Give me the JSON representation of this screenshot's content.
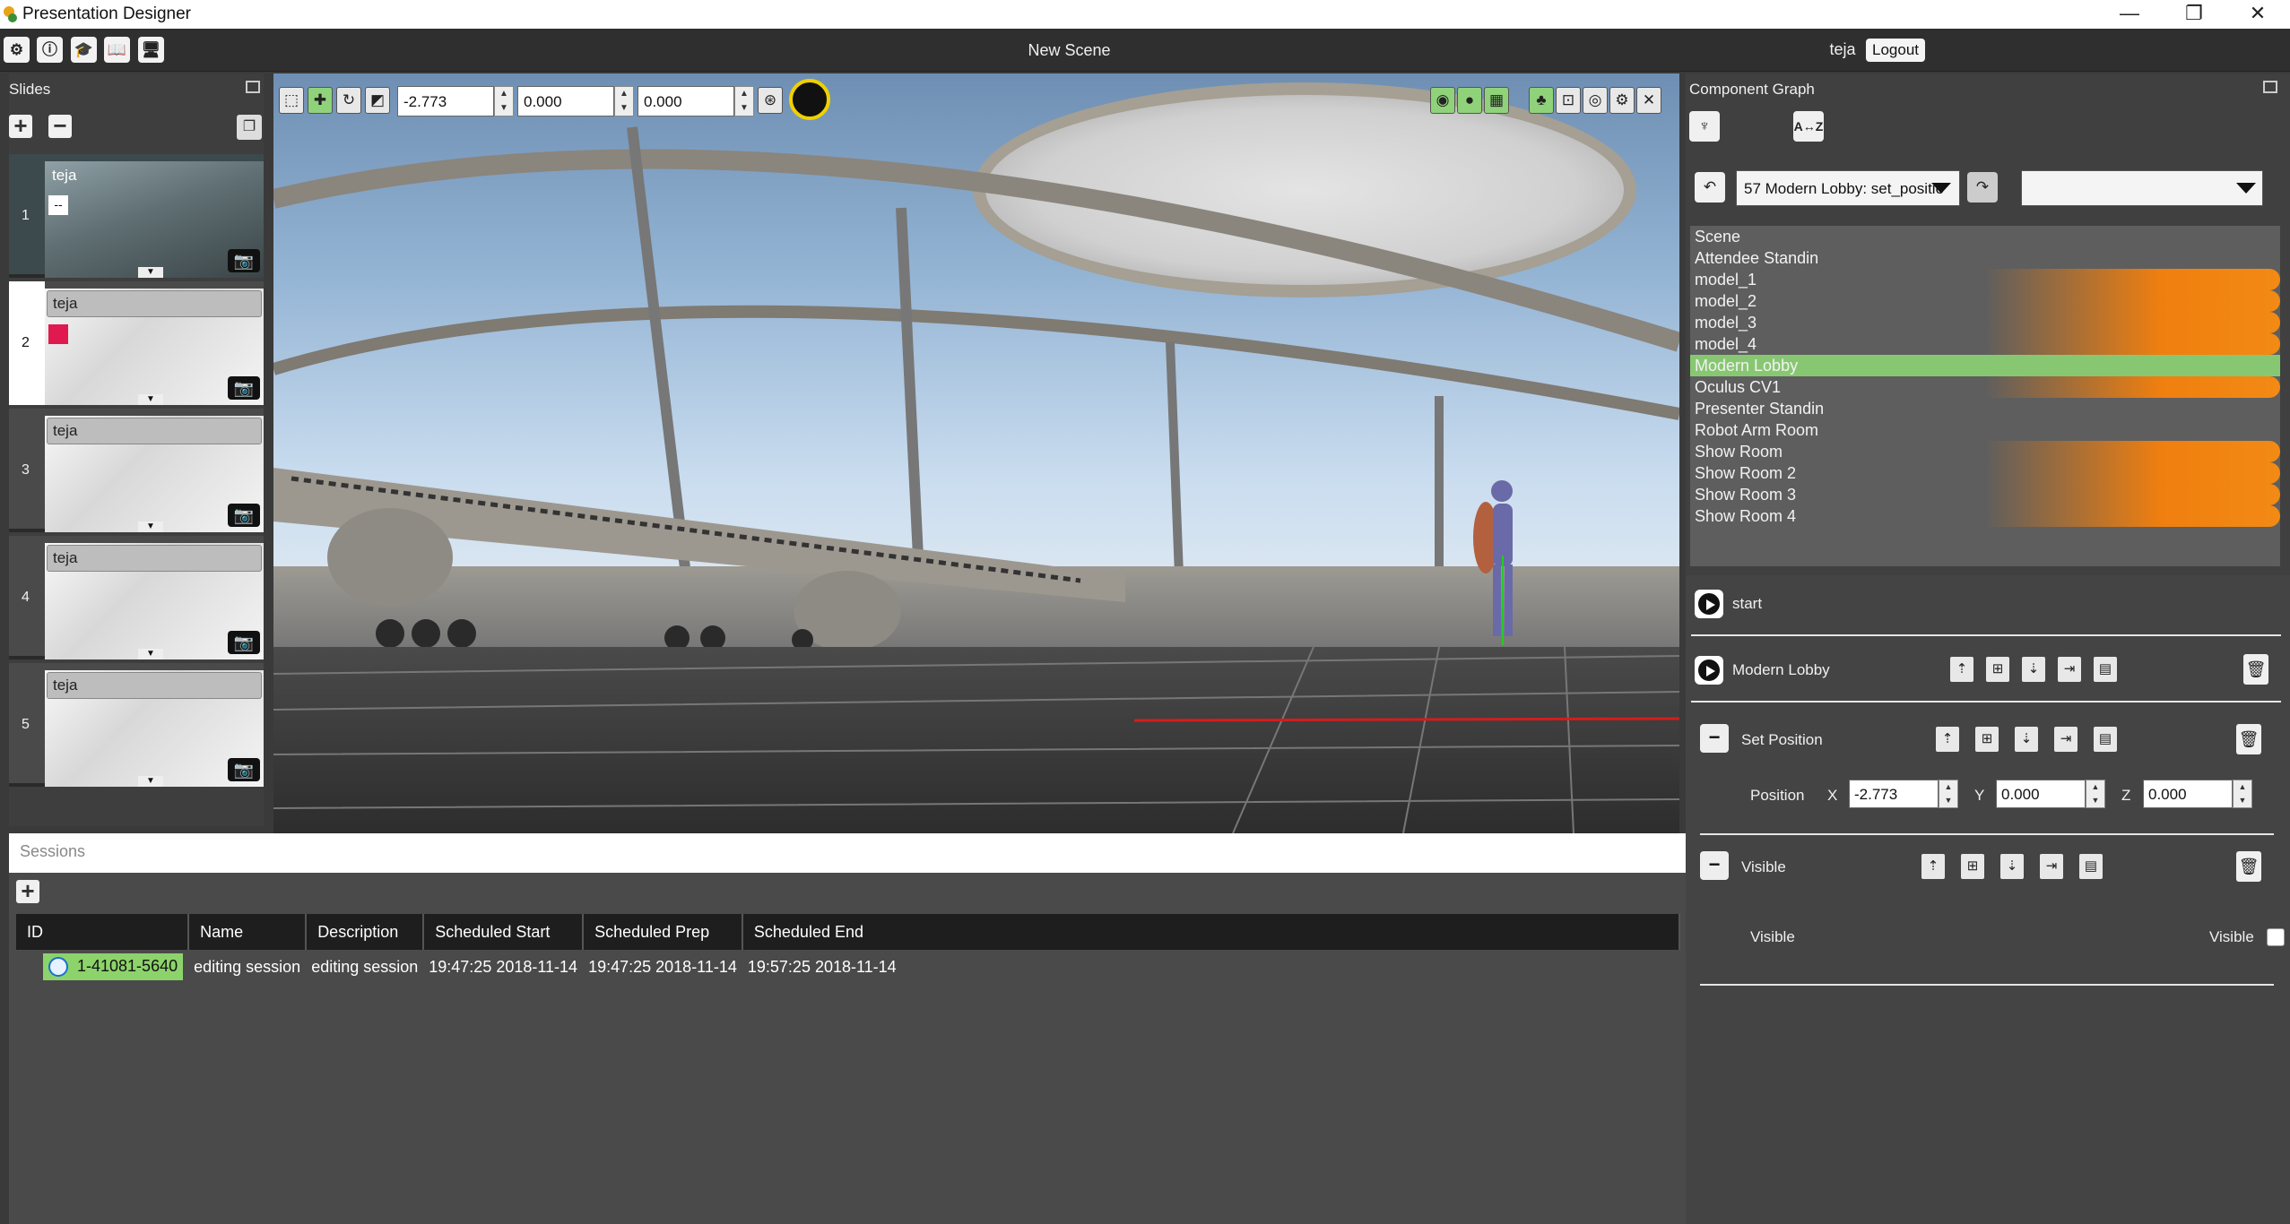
{
  "window": {
    "title": "Presentation Designer",
    "minimize": "—",
    "maximize": "❐",
    "close": "✕"
  },
  "menubar": {
    "icons": [
      "gear-icon",
      "info-icon",
      "graduation-cap-icon",
      "book-icon",
      "display-icon"
    ],
    "icon_glyphs": [
      "⚙",
      "ⓘ",
      "🎓",
      "📖",
      "🖥"
    ],
    "scene_title": "New Scene",
    "user": "teja",
    "logout": "Logout"
  },
  "slides": {
    "header": "Slides",
    "add": "+",
    "remove": "−",
    "items": [
      {
        "num": "1",
        "name": "teja",
        "tag": "--"
      },
      {
        "num": "2",
        "name": "teja"
      },
      {
        "num": "3",
        "name": "teja"
      },
      {
        "num": "4",
        "name": "teja"
      },
      {
        "num": "5",
        "name": "teja"
      }
    ]
  },
  "viewport": {
    "x": "-2.773",
    "y": "0.000",
    "z": "0.000"
  },
  "sessions": {
    "header": "Sessions",
    "add": "+",
    "columns": [
      "ID",
      "Name",
      "Description",
      "Scheduled Start",
      "Scheduled Prep",
      "Scheduled End"
    ],
    "rows": [
      {
        "id": "1-41081-5640",
        "name": "editing session",
        "description": "editing session",
        "start": "19:47:25 2018-11-14",
        "prep": "19:47:25 2018-11-14",
        "end": "19:57:25 2018-11-14"
      }
    ]
  },
  "component_graph": {
    "header": "Component Graph",
    "sort_label": "A↔Z",
    "history_select": "57 Modern Lobby: set_positio",
    "second_select": "",
    "items": [
      {
        "label": "Scene",
        "heat": false
      },
      {
        "label": "Attendee Standin",
        "heat": false
      },
      {
        "label": "model_1",
        "heat": true
      },
      {
        "label": "model_2",
        "heat": true
      },
      {
        "label": "model_3",
        "heat": true
      },
      {
        "label": "model_4",
        "heat": true
      },
      {
        "label": "Modern Lobby",
        "heat": false,
        "selected": true
      },
      {
        "label": "Oculus CV1",
        "heat": true
      },
      {
        "label": "Presenter Standin",
        "heat": false
      },
      {
        "label": "Robot Arm Room",
        "heat": false
      },
      {
        "label": "Show Room",
        "heat": true
      },
      {
        "label": "Show Room 2",
        "heat": true
      },
      {
        "label": "Show Room 3",
        "heat": true
      },
      {
        "label": "Show Room 4",
        "heat": true
      }
    ],
    "nodes": {
      "start": "start",
      "object": "Modern Lobby",
      "set_position": "Set Position",
      "position_label": "Position",
      "x_label": "X",
      "y_label": "Y",
      "z_label": "Z",
      "x": "-2.773",
      "y": "0.000",
      "z": "0.000",
      "visible_action": "Visible",
      "visible_left": "Visible",
      "visible_right": "Visible"
    }
  }
}
